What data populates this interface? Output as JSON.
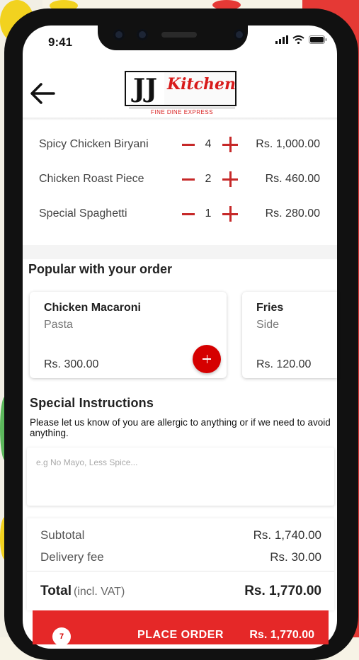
{
  "status_bar": {
    "time": "9:41"
  },
  "header": {
    "logo_jj": "JJ",
    "logo_kitchen": "Kitchen",
    "logo_tagline": "FINE DINE EXPRESS"
  },
  "cart": {
    "items": [
      {
        "name": "Spicy Chicken Biryani",
        "qty": "4",
        "price": "Rs. 1,000.00"
      },
      {
        "name": "Chicken Roast Piece",
        "qty": "2",
        "price": "Rs. 460.00"
      },
      {
        "name": "Special Spaghetti",
        "qty": "1",
        "price": "Rs. 280.00"
      }
    ]
  },
  "popular": {
    "title": "Popular with your order",
    "items": [
      {
        "name": "Chicken Macaroni",
        "type": "Pasta",
        "price": "Rs. 300.00"
      },
      {
        "name": "Fries",
        "type": "Side",
        "price": "Rs. 120.00"
      }
    ]
  },
  "instructions": {
    "title": "Special Instructions",
    "description": "Please let us know of you are allergic to anything or if we need to avoid anything.",
    "placeholder": "e.g No Mayo, Less Spice..."
  },
  "summary": {
    "subtotal_label": "Subtotal",
    "subtotal_value": "Rs. 1,740.00",
    "delivery_label": "Delivery fee",
    "delivery_value": "Rs. 30.00",
    "total_label": "Total",
    "total_note": "(incl. VAT)",
    "total_value": "Rs. 1,770.00"
  },
  "place_order": {
    "count": "7",
    "label": "PLACE ORDER",
    "price": "Rs. 1,770.00"
  },
  "colors": {
    "accent": "#d50000",
    "button": "#e52828",
    "background_red": "#e53935"
  }
}
